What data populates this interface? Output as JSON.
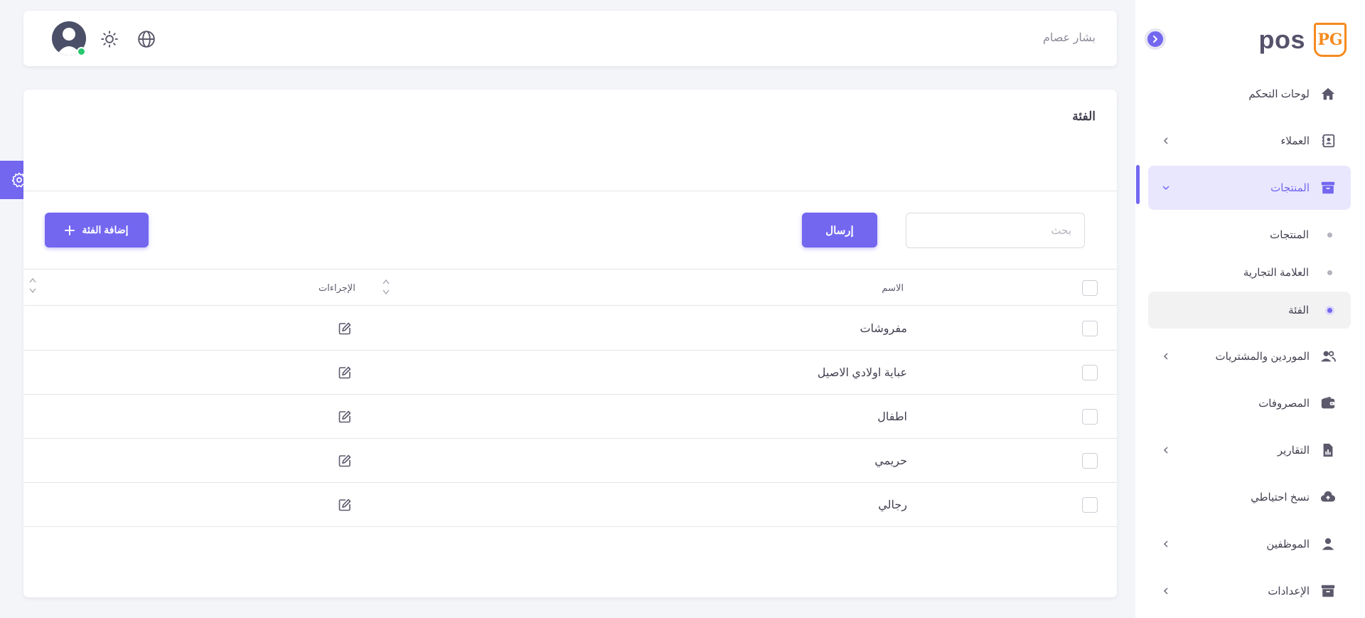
{
  "brand": {
    "badge": "PG",
    "name": "pos",
    "accent": "#7367f0",
    "badge_color": "#f58a1f"
  },
  "header": {
    "user_name": "بشار عصام",
    "icons": [
      "globe-icon",
      "sun-icon",
      "user-avatar"
    ]
  },
  "sidebar": {
    "items": [
      {
        "label": "لوحات التحكم",
        "icon": "home-icon",
        "has_children": false
      },
      {
        "label": "العملاء",
        "icon": "contacts-icon",
        "has_children": true
      },
      {
        "label": "المنتجات",
        "icon": "archive-icon",
        "has_children": true,
        "expanded": true
      },
      {
        "label": "الموردين والمشتريات",
        "icon": "users-icon",
        "has_children": true
      },
      {
        "label": "المصروفات",
        "icon": "wallet-icon",
        "has_children": false
      },
      {
        "label": "التقارير",
        "icon": "report-icon",
        "has_children": true
      },
      {
        "label": "نسخ احتياطي",
        "icon": "cloud-upload-icon",
        "has_children": false
      },
      {
        "label": "الموظفين",
        "icon": "user-icon",
        "has_children": true
      },
      {
        "label": "الإعدادات",
        "icon": "archive-icon",
        "has_children": true
      }
    ],
    "sub_items": [
      {
        "label": "المنتجات",
        "active": false
      },
      {
        "label": "العلامة التجارية",
        "active": false
      },
      {
        "label": "الفئة",
        "active": true
      }
    ]
  },
  "page": {
    "title": "الفئة",
    "search_placeholder": "بحث",
    "send_label": "إرسال",
    "add_label": "إضافة الفئة"
  },
  "table": {
    "columns": [
      "الاسم",
      "الإجراءات"
    ],
    "rows": [
      {
        "name": "مفروشات"
      },
      {
        "name": "عباية اولادي الاصيل"
      },
      {
        "name": "اطفال"
      },
      {
        "name": "حريمي"
      },
      {
        "name": "رجالي"
      }
    ]
  }
}
